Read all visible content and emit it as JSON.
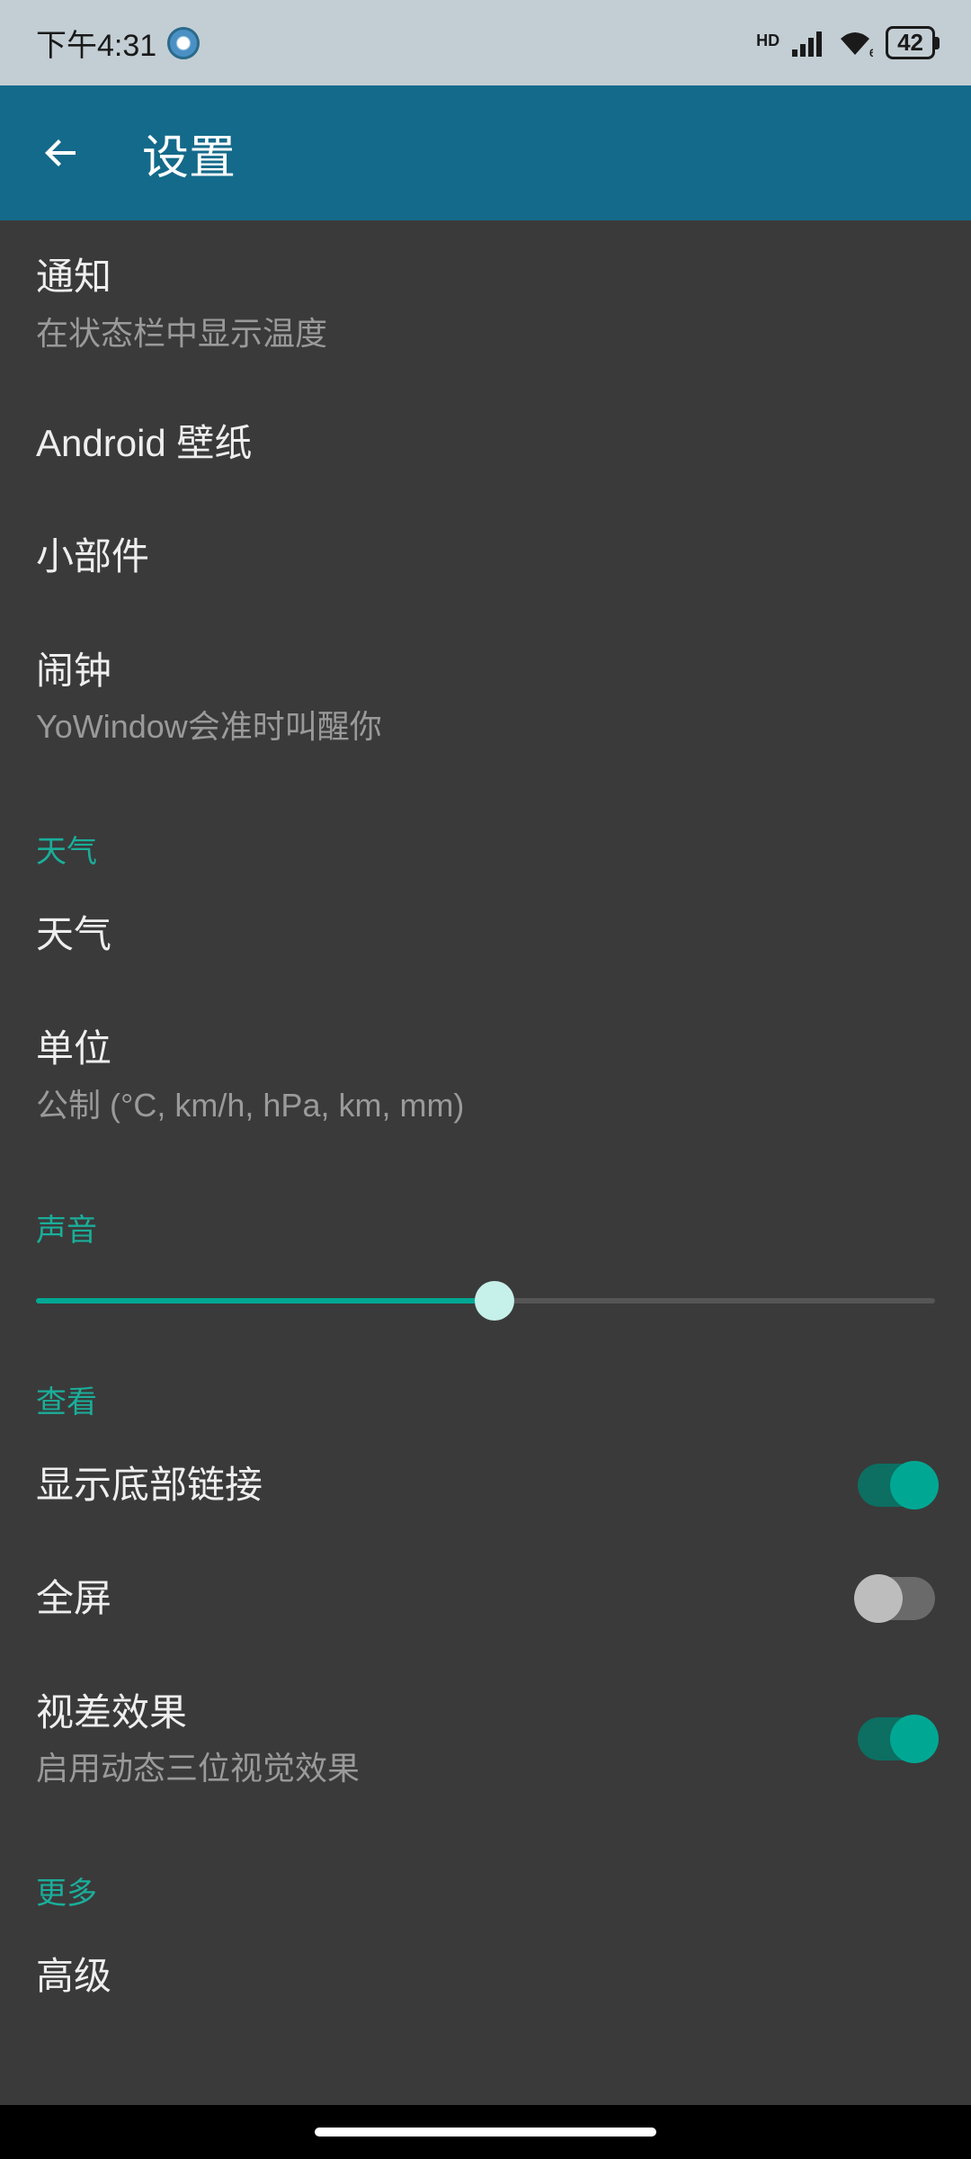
{
  "status": {
    "time": "下午4:31",
    "hd": "HD",
    "wifi_note": "6",
    "battery": "42"
  },
  "header": {
    "title": "设置"
  },
  "items": {
    "notification": {
      "title": "通知",
      "sub": "在状态栏中显示温度"
    },
    "wallpaper": {
      "title": "Android 壁纸"
    },
    "widget": {
      "title": "小部件"
    },
    "alarm": {
      "title": "闹钟",
      "sub": "YoWindow会准时叫醒你"
    },
    "weather": {
      "title": "天气"
    },
    "units": {
      "title": "单位",
      "sub": "公制 (°C, km/h, hPa, km, mm)"
    },
    "bottom_links": {
      "title": "显示底部链接"
    },
    "fullscreen": {
      "title": "全屏"
    },
    "parallax": {
      "title": "视差效果",
      "sub": "启用动态三位视觉效果"
    },
    "advanced": {
      "title": "高级"
    }
  },
  "sections": {
    "weather": "天气",
    "sound": "声音",
    "view": "查看",
    "more": "更多"
  },
  "slider": {
    "value_pct": 51
  },
  "toggles": {
    "bottom_links": true,
    "fullscreen": false,
    "parallax": true
  },
  "colors": {
    "accent": "#00a894",
    "appbar": "#146a8a",
    "bg": "#3a3a3a"
  }
}
